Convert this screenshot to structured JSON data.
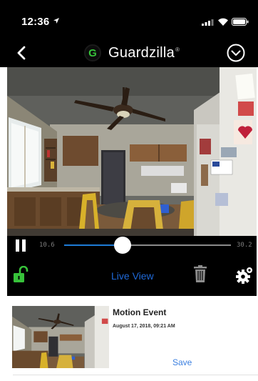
{
  "status_bar": {
    "time": "12:36",
    "icons": [
      "location-arrow-icon",
      "cellular-signal-icon",
      "wifi-icon",
      "battery-icon"
    ]
  },
  "nav": {
    "back_icon": "back-chevron-icon",
    "logo_letter": "G",
    "logo_text": "Guardzilla",
    "logo_mark": "®",
    "menu_icon": "chevron-down-circle-icon"
  },
  "player": {
    "time_start": "10.6",
    "time_end": "30.2",
    "progress": 0.35,
    "pause_icon": "pause-icon"
  },
  "controls": {
    "lock_icon": "unlock-icon",
    "live_view_label": "Live View",
    "trash_icon": "trash-icon",
    "settings_icon": "gear-icon"
  },
  "events": [
    {
      "title": "Motion Event",
      "date": "August 17, 2018, 09:21 AM",
      "action": "Save"
    }
  ],
  "colors": {
    "accent_green": "#37c23a",
    "accent_blue": "#1f69d8",
    "background_dark": "#000000"
  }
}
